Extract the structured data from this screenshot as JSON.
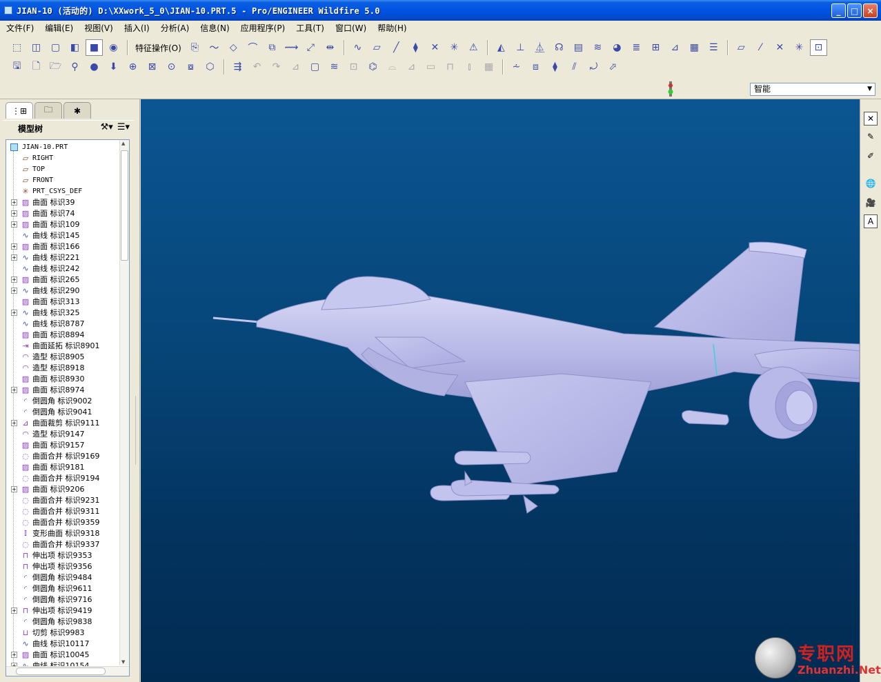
{
  "window": {
    "title": "JIAN-10 (活动的) D:\\XXwork_5_0\\JIAN-10.PRT.5 - Pro/ENGINEER Wildfire 5.0"
  },
  "menu": [
    "文件(F)",
    "编辑(E)",
    "视图(V)",
    "插入(I)",
    "分析(A)",
    "信息(N)",
    "应用程序(P)",
    "工具(T)",
    "窗口(W)",
    "帮助(H)"
  ],
  "toolbar": {
    "feature_ops_label": "特征操作(O)",
    "filter_value": "智能"
  },
  "panel": {
    "title": "模型树",
    "tabs": [
      "model-tree",
      "folder-browser",
      "favorites"
    ]
  },
  "tree": [
    {
      "label": "JIAN-10.PRT",
      "icon": "part-icon",
      "expand": false,
      "root": true
    },
    {
      "label": "RIGHT",
      "icon": "datum-plane-icon",
      "expand": false
    },
    {
      "label": "TOP",
      "icon": "datum-plane-icon",
      "expand": false
    },
    {
      "label": "FRONT",
      "icon": "datum-plane-icon",
      "expand": false
    },
    {
      "label": "PRT_CSYS_DEF",
      "icon": "csys-icon",
      "expand": false
    },
    {
      "label": "曲面 标识39",
      "icon": "surface-icon",
      "expand": true
    },
    {
      "label": "曲面 标识74",
      "icon": "surface-icon",
      "expand": true
    },
    {
      "label": "曲面 标识109",
      "icon": "surface-icon",
      "expand": true
    },
    {
      "label": "曲线 标识145",
      "icon": "curve-icon",
      "expand": false
    },
    {
      "label": "曲面 标识166",
      "icon": "surface-icon",
      "expand": true
    },
    {
      "label": "曲线 标识221",
      "icon": "curve-icon",
      "expand": true
    },
    {
      "label": "曲线 标识242",
      "icon": "curve-icon",
      "expand": false
    },
    {
      "label": "曲面 标识265",
      "icon": "surface-icon",
      "expand": true
    },
    {
      "label": "曲线 标识290",
      "icon": "curve-icon",
      "expand": true
    },
    {
      "label": "曲面 标识313",
      "icon": "surface-icon",
      "expand": false
    },
    {
      "label": "曲线 标识325",
      "icon": "curve-icon",
      "expand": true
    },
    {
      "label": "曲线 标识8787",
      "icon": "curve-icon",
      "expand": false
    },
    {
      "label": "曲面 标识8894",
      "icon": "surface-icon",
      "expand": false
    },
    {
      "label": "曲面延拓 标识8901",
      "icon": "extend-icon",
      "expand": false
    },
    {
      "label": "造型 标识8905",
      "icon": "style-icon",
      "expand": false
    },
    {
      "label": "造型 标识8918",
      "icon": "style-icon",
      "expand": false
    },
    {
      "label": "曲面 标识8930",
      "icon": "surface-icon",
      "expand": false
    },
    {
      "label": "曲面 标识8974",
      "icon": "surface-icon",
      "expand": true
    },
    {
      "label": "倒圆角 标识9002",
      "icon": "round-icon",
      "expand": false
    },
    {
      "label": "倒圆角 标识9041",
      "icon": "round-icon",
      "expand": false
    },
    {
      "label": "曲面裁剪 标识9111",
      "icon": "trim-icon",
      "expand": true
    },
    {
      "label": "造型 标识9147",
      "icon": "style-icon",
      "expand": false
    },
    {
      "label": "曲面 标识9157",
      "icon": "surface-icon",
      "expand": false
    },
    {
      "label": "曲面合并 标识9169",
      "icon": "merge-icon",
      "expand": false
    },
    {
      "label": "曲面 标识9181",
      "icon": "surface-icon",
      "expand": false
    },
    {
      "label": "曲面合并 标识9194",
      "icon": "merge-icon",
      "expand": false
    },
    {
      "label": "曲面 标识9206",
      "icon": "surface-icon",
      "expand": true
    },
    {
      "label": "曲面合并 标识9231",
      "icon": "merge-icon",
      "expand": false
    },
    {
      "label": "曲面合并 标识9311",
      "icon": "merge-icon",
      "expand": false
    },
    {
      "label": "曲面合并 标识9359",
      "icon": "merge-icon",
      "expand": false
    },
    {
      "label": "变形曲面 标识9318",
      "icon": "warp-icon",
      "expand": false
    },
    {
      "label": "曲面合并 标识9337",
      "icon": "merge-icon",
      "expand": false
    },
    {
      "label": "伸出项 标识9353",
      "icon": "protrusion-icon",
      "expand": false
    },
    {
      "label": "伸出项 标识9356",
      "icon": "protrusion-icon",
      "expand": false
    },
    {
      "label": "倒圆角 标识9484",
      "icon": "round-icon",
      "expand": false
    },
    {
      "label": "倒圆角 标识9611",
      "icon": "round-icon",
      "expand": false
    },
    {
      "label": "倒圆角 标识9716",
      "icon": "round-icon",
      "expand": false
    },
    {
      "label": "伸出项 标识9419",
      "icon": "protrusion-icon",
      "expand": true
    },
    {
      "label": "倒圆角 标识9838",
      "icon": "round-icon",
      "expand": false
    },
    {
      "label": "切剪 标识9983",
      "icon": "cut-icon",
      "expand": false
    },
    {
      "label": "曲线 标识10117",
      "icon": "curve-icon",
      "expand": false
    },
    {
      "label": "曲面 标识10045",
      "icon": "surface-icon",
      "expand": true
    },
    {
      "label": "曲线 标识10154",
      "icon": "curve-icon",
      "expand": true
    }
  ],
  "watermark": {
    "cn": "专职网",
    "en": "Zhuanzhi.Net"
  }
}
